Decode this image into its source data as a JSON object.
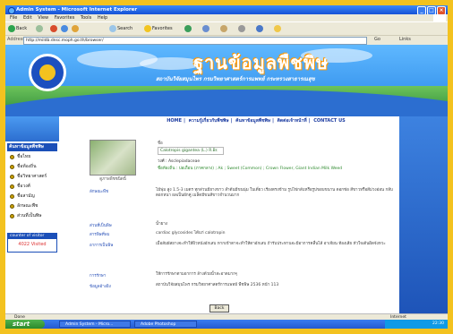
{
  "window": {
    "title": "Admin System - Microsoft Internet Explorer",
    "menu": [
      "File",
      "Edit",
      "View",
      "Favorites",
      "Tools",
      "Help"
    ]
  },
  "toolbar": {
    "back": "Back",
    "search": "Search",
    "favorites": "Favorites"
  },
  "address": {
    "label": "Address",
    "url": "http://mildb.dnsc.moph.go.th/browser/",
    "go": "Go",
    "links": "Links"
  },
  "site": {
    "title": "ฐานข้อมูลพืชพิษ",
    "subtitle": "สถาบันวิจัยสมุนไพร กรมวิทยาศาสตร์การแพทย์ กระทรวงสาธารณสุข"
  },
  "topnav": [
    "HOME",
    "ความรู้เกี่ยวกับพืชพิษ",
    "ค้นหาข้อมูลพืชพิษ",
    "ติดต่อเจ้าหน้าที่",
    "CONTACT US"
  ],
  "sidebar": {
    "menu_title": "ค้นหาข้อมูลพืชพิษ",
    "items": [
      "ชื่อไทย",
      "ชื่อท้องถิ่น",
      "ชื่อวิทยาศาสตร์",
      "ชื่อวงศ์",
      "ชื่อสามัญ",
      "ลักษณะพืช",
      "ส่วนที่เป็นพิษ"
    ],
    "counter_title": "counter of visitor",
    "counter_value": "4022 Visited"
  },
  "detail": {
    "label_top": "ชื่อ",
    "scientific_name": "Calotropis gigantea (L.) R.Br.",
    "family": "วงศ์ : Asclepiadaceae",
    "image_caption": "ดูภาพพืชชนิดนี้",
    "description": "ชื่อท้องถิ่น : ปอเถื่อน (ภาคกลาง) ; Ak ; Sweet (Common) ; Crown Flower, Giant Indian Milk Weed",
    "rows": [
      {
        "label": "ลักษณะพืช",
        "text": "ไม้พุ่ม สูง 1.5-3 เมตร ทุกส่วนมียางขาว ลำต้นมีขนนุ่ม ใบเดี่ยว เรียงตรงข้าม รูปไข่กลับหรือรูปขอบขนาน ดอกช่อ สีขาวหรือสีม่วงอ่อน กลีบดอกหนา ผลเป็นฝักคู่ เมล็ดมีขนสีขาวจำนวนมาก"
      },
      {
        "label": "ส่วนที่เป็นพิษ",
        "text": "น้ำยาง"
      },
      {
        "label": "สารพิษที่พบ",
        "text": "cardiac glycosides ได้แก่ calotropin"
      },
      {
        "label": "อาการเป็นพิษ",
        "text": "เมื่อสัมผัสยางจะทำให้ผิวหนังอักเสบ หากเข้าตาจะทำให้ตาอักเสบ ถ้ารับประทานจะมีอาการคลื่นไส้ อาเจียน ท้องเสีย หัวใจเต้นผิดจังหวะ"
      },
      {
        "label": "การรักษา",
        "text": "ให้การรักษาตามอาการ ล้างด้วยน้ำสะอาดมากๆ"
      },
      {
        "label": "ข้อมูลอ้างอิง",
        "text": "สถาบันวิจัยสมุนไพร กรมวิทยาศาสตร์การแพทย์ พืชพิษ 2536 หน้า 113"
      }
    ],
    "back_button": "Back"
  },
  "statusbar": {
    "left": "Done",
    "right": "Internet"
  },
  "taskbar": {
    "start": "start",
    "tasks": [
      "Admin System - Micro...",
      "Adobe Photoshop"
    ],
    "clock": "22:30"
  }
}
